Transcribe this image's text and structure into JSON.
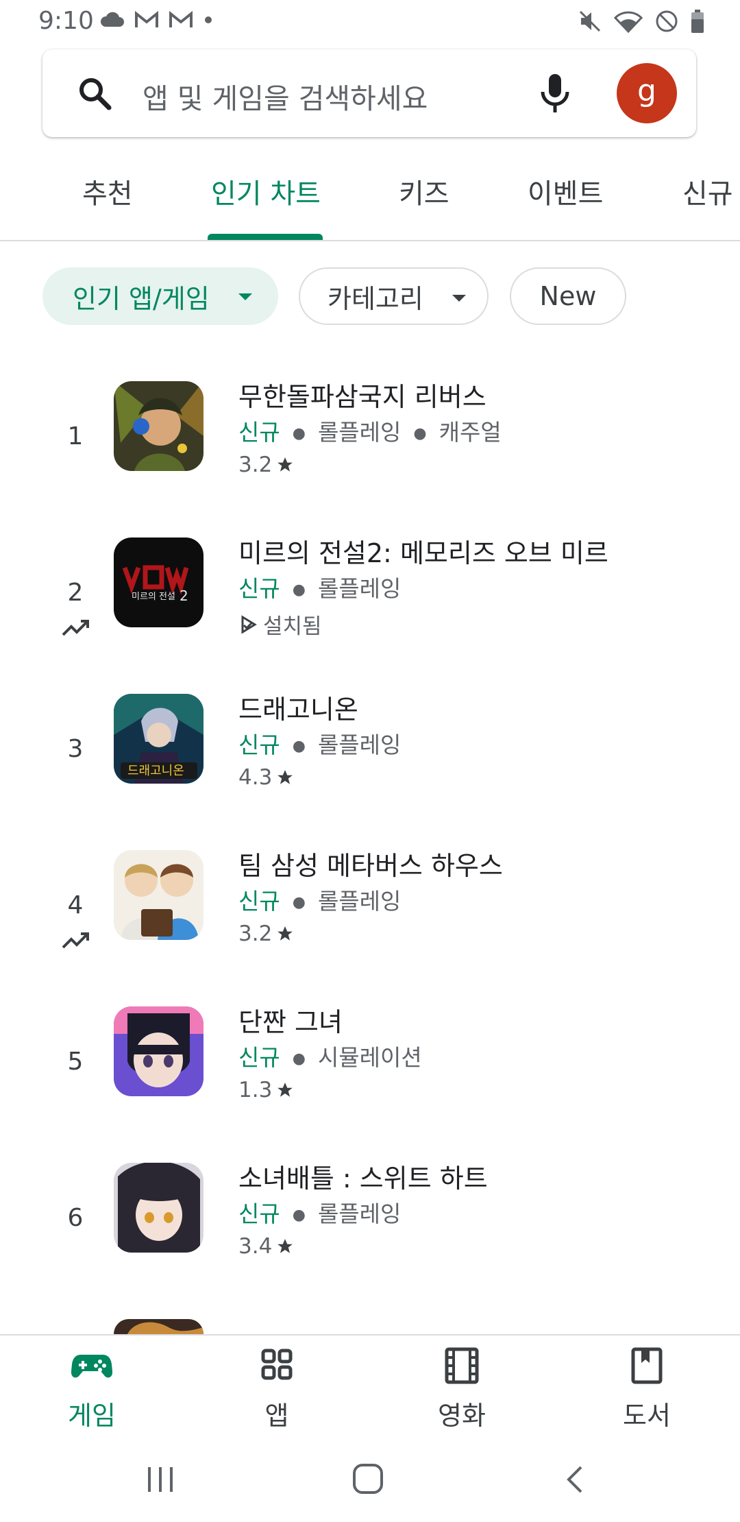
{
  "status_bar": {
    "time": "9:10",
    "left_icons": [
      "cloud-icon",
      "gmail-icon",
      "gmail-icon",
      "dot-icon"
    ],
    "right_icons": [
      "mute-icon",
      "wifi-icon",
      "do-not-disturb-icon",
      "battery-icon"
    ]
  },
  "search": {
    "placeholder": "앱 및 게임을 검색하세요",
    "avatar_letter": "g",
    "avatar_color": "#c5361b"
  },
  "tabs": [
    {
      "label": "추천",
      "active": false
    },
    {
      "label": "인기 차트",
      "active": true
    },
    {
      "label": "키즈",
      "active": false
    },
    {
      "label": "이벤트",
      "active": false
    },
    {
      "label": "신규",
      "active": false
    }
  ],
  "filters": {
    "apps_games": "인기 앱/게임",
    "category": "카테고리",
    "new": "New"
  },
  "chart_list": [
    {
      "rank": "1",
      "trending": false,
      "title": "무한돌파삼국지 리버스",
      "new_label": "신규",
      "genre": "롤플레잉",
      "genre2": "캐주얼",
      "rating": "3.2",
      "installed": ""
    },
    {
      "rank": "2",
      "trending": true,
      "title": "미르의 전설2: 메모리즈 오브 미르",
      "new_label": "신규",
      "genre": "롤플레잉",
      "genre2": "",
      "rating": "",
      "installed": "설치됨"
    },
    {
      "rank": "3",
      "trending": false,
      "title": "드래고니온",
      "new_label": "신규",
      "genre": "롤플레잉",
      "genre2": "",
      "rating": "4.3",
      "installed": ""
    },
    {
      "rank": "4",
      "trending": true,
      "title": "팀 삼성 메타버스 하우스",
      "new_label": "신규",
      "genre": "롤플레잉",
      "genre2": "",
      "rating": "3.2",
      "installed": ""
    },
    {
      "rank": "5",
      "trending": false,
      "title": "단짠 그녀",
      "new_label": "신규",
      "genre": "시뮬레이션",
      "genre2": "",
      "rating": "1.3",
      "installed": ""
    },
    {
      "rank": "6",
      "trending": false,
      "title": "소녀배틀 : 스위트 하트",
      "new_label": "신규",
      "genre": "롤플레잉",
      "genre2": "",
      "rating": "3.4",
      "installed": ""
    }
  ],
  "bottom_nav": [
    {
      "label": "게임",
      "icon": "gamepad-icon",
      "active": true
    },
    {
      "label": "앱",
      "icon": "apps-grid-icon",
      "active": false
    },
    {
      "label": "영화",
      "icon": "film-icon",
      "active": false
    },
    {
      "label": "도서",
      "icon": "book-icon",
      "active": false
    }
  ],
  "colors": {
    "accent": "#01875f",
    "accent_chip_bg": "#e6f3ef"
  }
}
